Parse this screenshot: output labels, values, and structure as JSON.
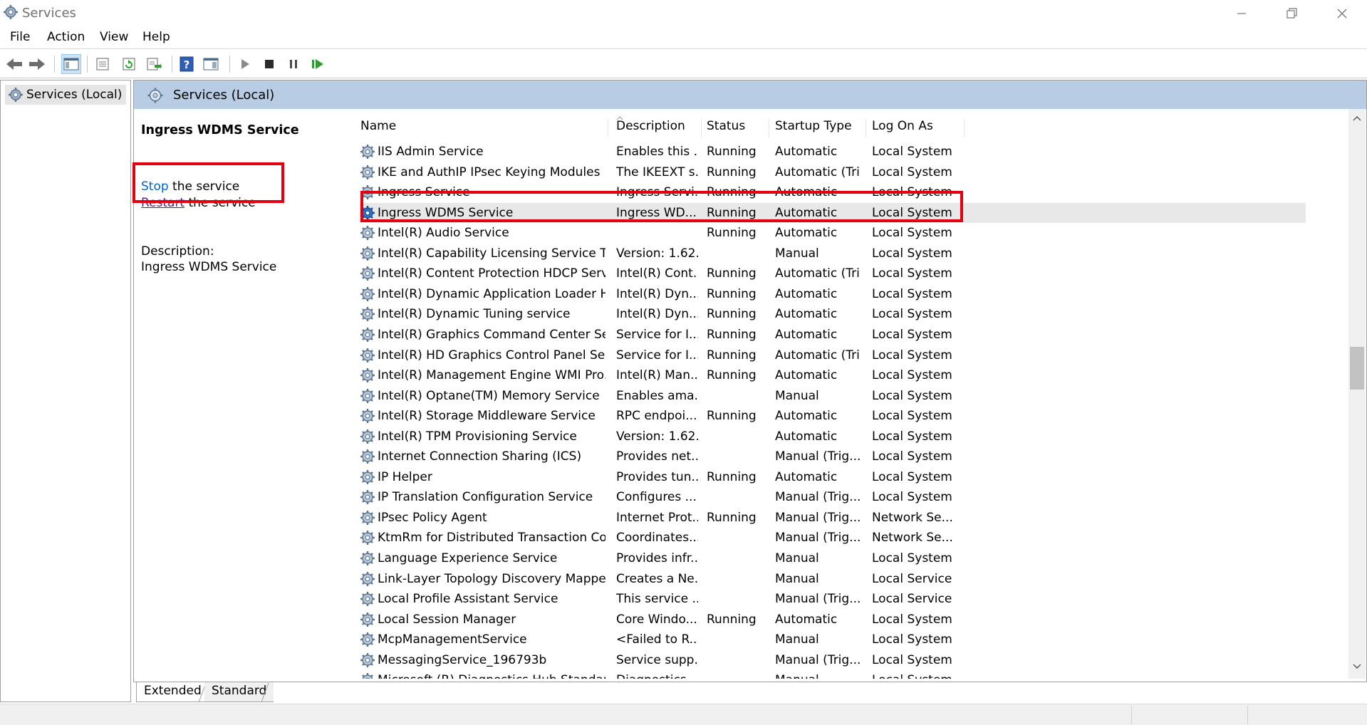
{
  "window": {
    "title": "Services"
  },
  "menu": {
    "items": [
      {
        "label": "File"
      },
      {
        "label": "Action"
      },
      {
        "label": "View"
      },
      {
        "label": "Help"
      }
    ]
  },
  "toolbar": {
    "buttons": [
      "back-icon",
      "forward-icon",
      "console-tree-icon",
      "properties-icon",
      "refresh-icon",
      "export-list-icon",
      "help-icon",
      "show-hide-action-pane-icon",
      "start-service-icon",
      "stop-service-icon",
      "pause-service-icon",
      "resume-service-icon"
    ]
  },
  "tree": {
    "root_label": "Services (Local)"
  },
  "main": {
    "header_title": "Services (Local)"
  },
  "details": {
    "service_name": "Ingress WDMS Service",
    "stop_link": "Stop",
    "stop_suffix": " the service",
    "restart_link": "Restart",
    "restart_suffix": " the service",
    "description_label": "Description:",
    "description_text": "Ingress WDMS Service"
  },
  "table": {
    "columns": {
      "name": "Name",
      "description": "Description",
      "status": "Status",
      "startup_type": "Startup Type",
      "log_on_as": "Log On As"
    },
    "selected_index": 3,
    "rows": [
      {
        "name": "IIS Admin Service",
        "description": "Enables this ...",
        "status": "Running",
        "startup": "Automatic",
        "logon": "Local System"
      },
      {
        "name": "IKE and AuthIP IPsec Keying Modules",
        "description": "The IKEEXT s...",
        "status": "Running",
        "startup": "Automatic (Tri...",
        "logon": "Local System"
      },
      {
        "name": "Ingress Service",
        "description": "Ingress Servi...",
        "status": "Running",
        "startup": "Automatic",
        "logon": "Local System"
      },
      {
        "name": "Ingress WDMS Service",
        "description": "Ingress WD...",
        "status": "Running",
        "startup": "Automatic",
        "logon": "Local System"
      },
      {
        "name": "Intel(R) Audio Service",
        "description": "",
        "status": "Running",
        "startup": "Automatic",
        "logon": "Local System"
      },
      {
        "name": "Intel(R) Capability Licensing Service TC...",
        "description": "Version: 1.62....",
        "status": "",
        "startup": "Manual",
        "logon": "Local System"
      },
      {
        "name": "Intel(R) Content Protection HDCP Servi...",
        "description": "Intel(R) Cont...",
        "status": "Running",
        "startup": "Automatic (Tri...",
        "logon": "Local System"
      },
      {
        "name": "Intel(R) Dynamic Application Loader H...",
        "description": "Intel(R) Dyn...",
        "status": "Running",
        "startup": "Automatic",
        "logon": "Local System"
      },
      {
        "name": "Intel(R) Dynamic Tuning service",
        "description": "Intel(R) Dyn...",
        "status": "Running",
        "startup": "Automatic",
        "logon": "Local System"
      },
      {
        "name": "Intel(R) Graphics Command Center Ser...",
        "description": "Service for I...",
        "status": "Running",
        "startup": "Automatic",
        "logon": "Local System"
      },
      {
        "name": "Intel(R) HD Graphics Control Panel Ser...",
        "description": "Service for I...",
        "status": "Running",
        "startup": "Automatic (Tri...",
        "logon": "Local System"
      },
      {
        "name": "Intel(R) Management Engine WMI Pro...",
        "description": "Intel(R) Man...",
        "status": "Running",
        "startup": "Automatic",
        "logon": "Local System"
      },
      {
        "name": "Intel(R) Optane(TM) Memory Service",
        "description": "Enables ama...",
        "status": "",
        "startup": "Manual",
        "logon": "Local System"
      },
      {
        "name": "Intel(R) Storage Middleware Service",
        "description": "RPC endpoi...",
        "status": "Running",
        "startup": "Automatic",
        "logon": "Local System"
      },
      {
        "name": "Intel(R) TPM Provisioning Service",
        "description": "Version: 1.62....",
        "status": "",
        "startup": "Automatic",
        "logon": "Local System"
      },
      {
        "name": "Internet Connection Sharing (ICS)",
        "description": "Provides net...",
        "status": "",
        "startup": "Manual (Trig...",
        "logon": "Local System"
      },
      {
        "name": "IP Helper",
        "description": "Provides tun...",
        "status": "Running",
        "startup": "Automatic",
        "logon": "Local System"
      },
      {
        "name": "IP Translation Configuration Service",
        "description": "Configures ...",
        "status": "",
        "startup": "Manual (Trig...",
        "logon": "Local System"
      },
      {
        "name": "IPsec Policy Agent",
        "description": "Internet Prot...",
        "status": "Running",
        "startup": "Manual (Trig...",
        "logon": "Network Se..."
      },
      {
        "name": "KtmRm for Distributed Transaction Co...",
        "description": "Coordinates...",
        "status": "",
        "startup": "Manual (Trig...",
        "logon": "Network Se..."
      },
      {
        "name": "Language Experience Service",
        "description": "Provides infr...",
        "status": "",
        "startup": "Manual",
        "logon": "Local System"
      },
      {
        "name": "Link-Layer Topology Discovery Mapper",
        "description": "Creates a Ne...",
        "status": "",
        "startup": "Manual",
        "logon": "Local Service"
      },
      {
        "name": "Local Profile Assistant Service",
        "description": "This service ...",
        "status": "",
        "startup": "Manual (Trig...",
        "logon": "Local Service"
      },
      {
        "name": "Local Session Manager",
        "description": "Core Windo...",
        "status": "Running",
        "startup": "Automatic",
        "logon": "Local System"
      },
      {
        "name": "McpManagementService",
        "description": "<Failed to R...",
        "status": "",
        "startup": "Manual",
        "logon": "Local System"
      },
      {
        "name": "MessagingService_196793b",
        "description": "Service supp...",
        "status": "",
        "startup": "Manual (Trig...",
        "logon": "Local System"
      },
      {
        "name": "Microsoft (R) Diagnostics Hub Standar...",
        "description": "Diagnostics ...",
        "status": "",
        "startup": "Manual",
        "logon": "Local System"
      }
    ]
  },
  "tabs": {
    "extended": "Extended",
    "standard": "Standard"
  }
}
